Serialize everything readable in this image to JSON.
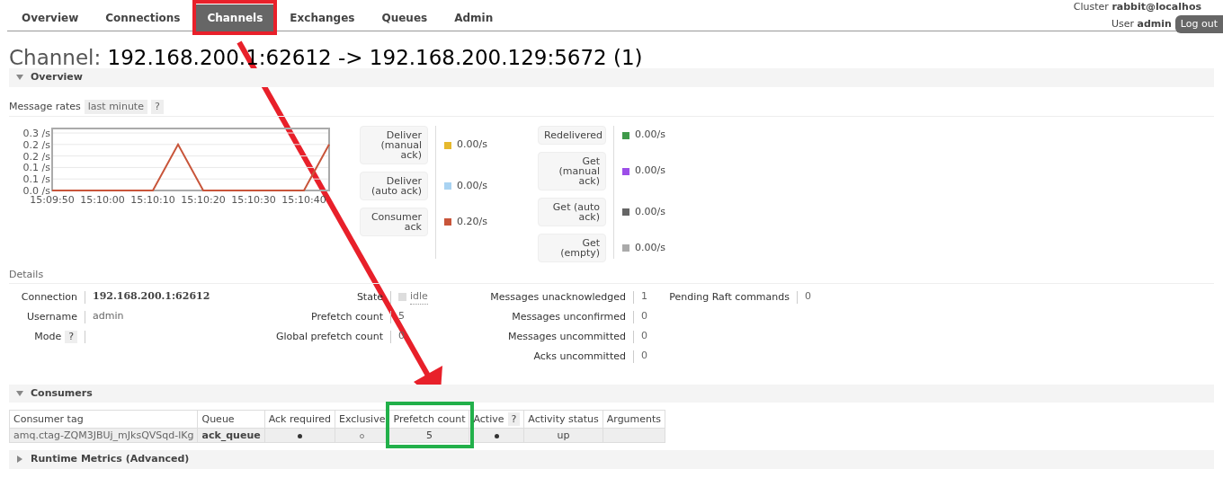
{
  "nav": {
    "tabs": [
      {
        "label": "Overview",
        "selected": false
      },
      {
        "label": "Connections",
        "selected": false
      },
      {
        "label": "Channels",
        "selected": true
      },
      {
        "label": "Exchanges",
        "selected": false
      },
      {
        "label": "Queues",
        "selected": false
      },
      {
        "label": "Admin",
        "selected": false
      }
    ],
    "cluster_label": "Cluster",
    "cluster": "rabbit@localhos",
    "user_label": "User",
    "user": "admin",
    "logout": "Log out"
  },
  "title": {
    "prefix": "Channel:",
    "name": "192.168.200.1:62612 -> 192.168.200.129:5672 (1)"
  },
  "overview": {
    "heading": "Overview",
    "expanded": true,
    "rates_label": "Message rates",
    "rates_period": "last minute",
    "help": "?",
    "chart_data": {
      "type": "line",
      "categories": [
        "15:09:50",
        null,
        "15:10:00",
        null,
        "15:10:10",
        null,
        "15:10:20",
        null,
        "15:10:30",
        null,
        "15:10:40",
        null
      ],
      "grid": true,
      "series": [
        {
          "color": "#c8553a",
          "values": [
            0,
            0,
            0,
            0,
            0,
            0.2,
            0,
            0,
            0,
            0,
            0,
            0.2
          ]
        }
      ],
      "ylim": [
        0,
        0.25
      ],
      "yticks": [
        {
          "value": 0,
          "label": "0.0 /s"
        },
        {
          "value": 0.05,
          "label": "0.1 /s"
        },
        {
          "value": 0.1,
          "label": "0.1 /s"
        },
        {
          "value": 0.15,
          "label": "0.2 /s"
        },
        {
          "value": 0.2,
          "label": "0.2 /s"
        },
        {
          "value": 0.25,
          "label": "0.3 /s"
        }
      ]
    },
    "legend_columns": [
      [
        {
          "label": "Deliver\n(manual\nack)",
          "color": "#e6b92e",
          "value": "0.00/s"
        },
        {
          "label": "Deliver\n(auto ack)",
          "color": "#a9d3f2",
          "value": "0.00/s"
        },
        {
          "label": "Consumer\nack",
          "color": "#c8553a",
          "value": "0.20/s"
        }
      ],
      [
        {
          "label": "Redelivered",
          "color": "#3f9a4a",
          "value": "0.00/s"
        },
        {
          "label": "Get\n(manual\nack)",
          "color": "#9c4ee8",
          "value": "0.00/s"
        },
        {
          "label": "Get (auto\nack)",
          "color": "#666666",
          "value": "0.00/s"
        },
        {
          "label": "Get\n(empty)",
          "color": "#aaaaaa",
          "value": "0.00/s"
        }
      ]
    ]
  },
  "details": {
    "heading": "Details",
    "groups": [
      [
        {
          "label": "Connection",
          "value": "192.168.200.1:62612",
          "kind": "bold"
        },
        {
          "label": "Username",
          "value": "admin",
          "kind": "plain"
        },
        {
          "label": "Mode",
          "help": "?",
          "kind": "help"
        }
      ],
      [
        {
          "label": "State",
          "value": "idle",
          "kind": "state"
        },
        {
          "label": "Prefetch count",
          "value": "5",
          "kind": "plain"
        },
        {
          "label": "Global prefetch count",
          "value": "0",
          "kind": "plain"
        }
      ],
      [
        {
          "label": "Messages unacknowledged",
          "value": "1",
          "kind": "plain"
        },
        {
          "label": "Messages unconfirmed",
          "value": "0",
          "kind": "plain"
        },
        {
          "label": "Messages uncommitted",
          "value": "0",
          "kind": "plain"
        },
        {
          "label": "Acks uncommitted",
          "value": "0",
          "kind": "plain"
        }
      ],
      [
        {
          "label": "Pending Raft commands",
          "value": "0",
          "kind": "plain"
        }
      ]
    ]
  },
  "consumers": {
    "heading": "Consumers",
    "expanded": true,
    "columns": [
      {
        "label": "Consumer tag"
      },
      {
        "label": "Queue"
      },
      {
        "label": "Ack required"
      },
      {
        "label": "Exclusive"
      },
      {
        "label": "Prefetch count"
      },
      {
        "label": "Active",
        "help": "?"
      },
      {
        "label": "Activity status"
      },
      {
        "label": "Arguments"
      }
    ],
    "rows": [
      {
        "consumer_tag": "amq.ctag-ZQM3JBUj_mJksQVSqd-lKg",
        "queue": "ack_queue",
        "ack_required": true,
        "exclusive": false,
        "prefetch_count": "5",
        "active": true,
        "activity_status": "up"
      }
    ]
  },
  "runtime_metrics": {
    "heading": "Runtime Metrics (Advanced)",
    "expanded": false
  }
}
